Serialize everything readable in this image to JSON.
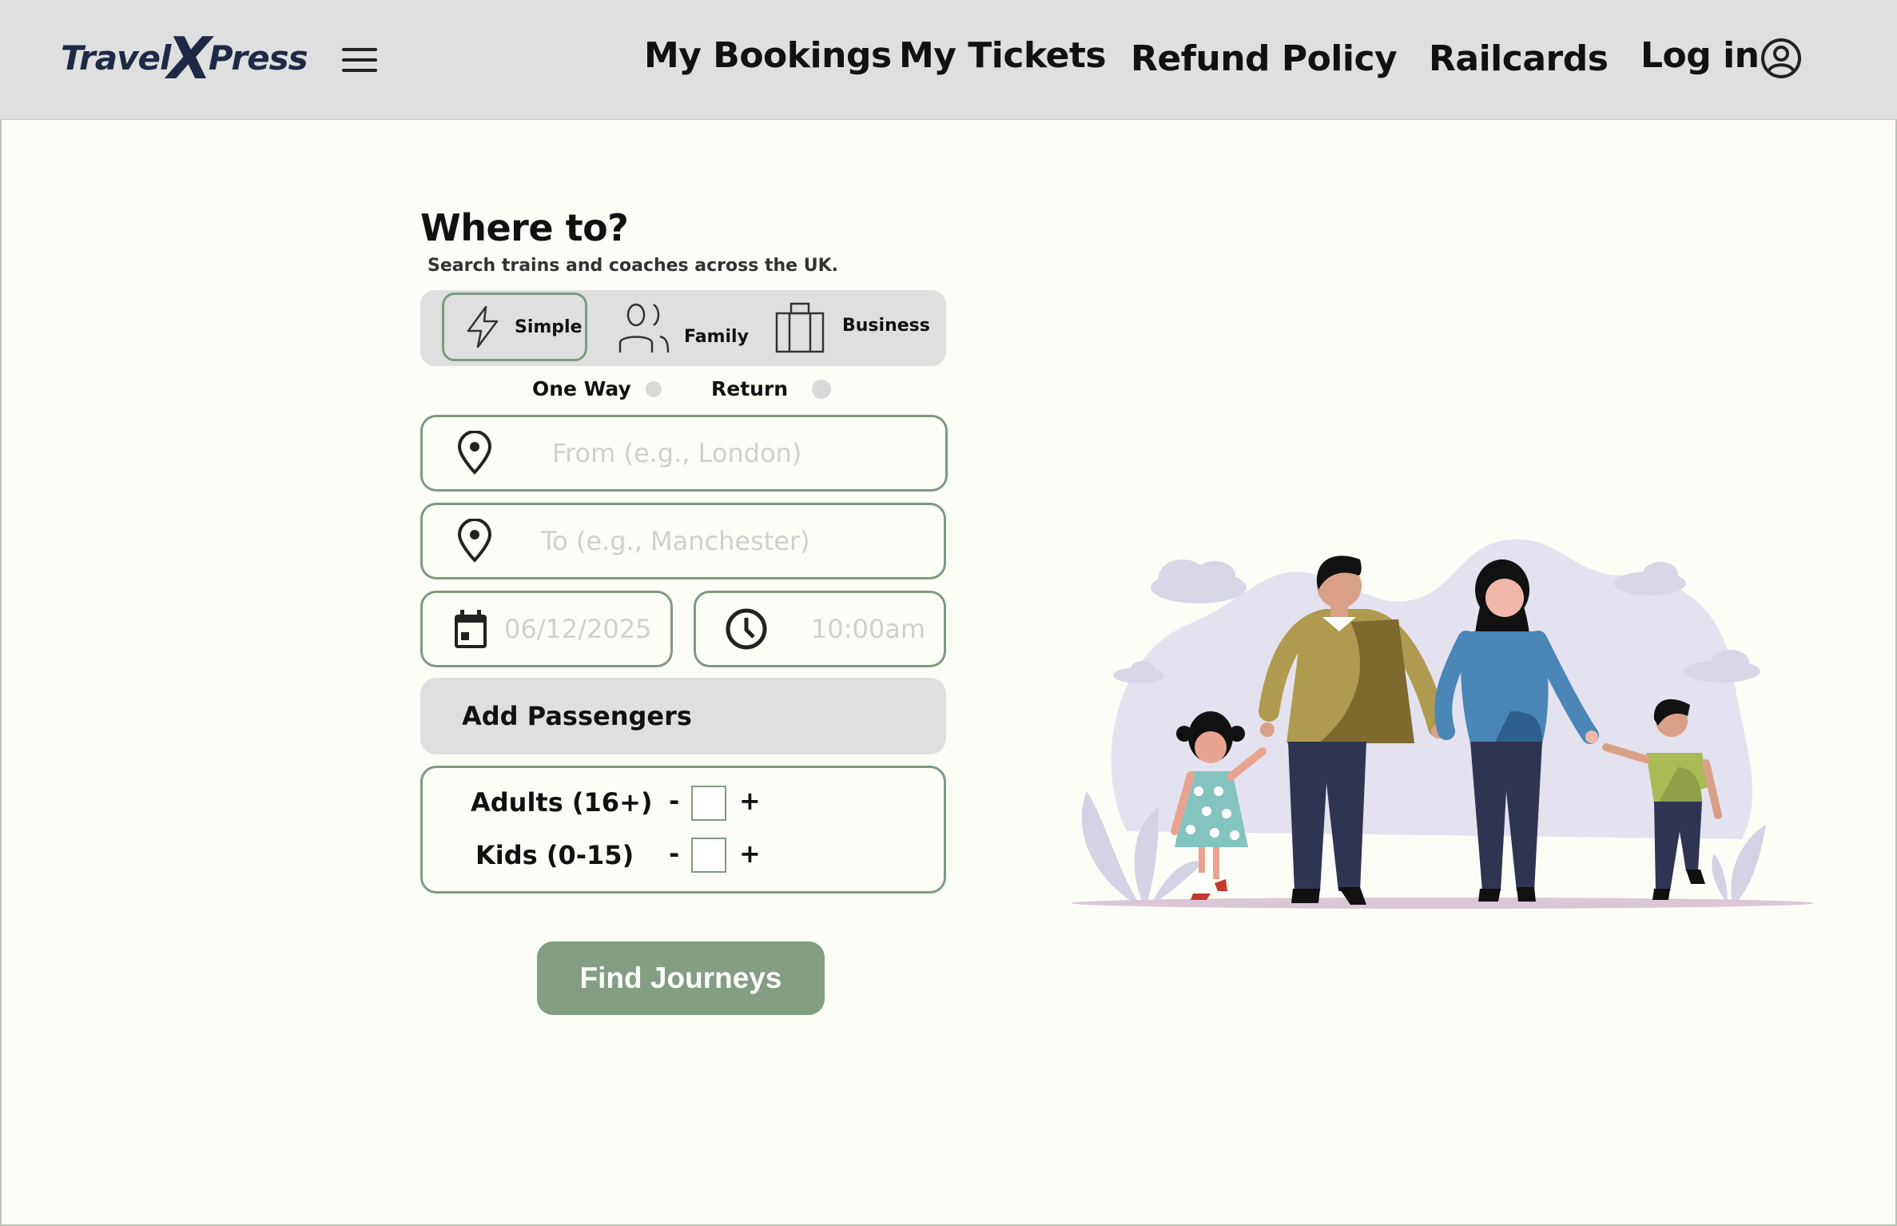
{
  "header": {
    "logo": {
      "part1": "Travel",
      "x": "X",
      "part2": "Press"
    },
    "nav": {
      "my_bookings": "My Bookings",
      "my_tickets": "My Tickets",
      "refund_policy": "Refund Policy",
      "railcards": "Railcards",
      "log_in": "Log in"
    }
  },
  "search": {
    "title": "Where to?",
    "subtitle": "Search trains and coaches across the UK.",
    "modes": {
      "simple": "Simple",
      "family": "Family",
      "business": "Business"
    },
    "selected_mode": "Simple",
    "trip_types": {
      "one_way": "One Way",
      "return": "Return"
    },
    "from": {
      "placeholder": "From (e.g., London)",
      "value": ""
    },
    "to": {
      "placeholder": "To (e.g., Manchester)",
      "value": ""
    },
    "date": {
      "placeholder": "06/12/2025"
    },
    "time": {
      "placeholder": "10:00am"
    },
    "add_passengers": "Add Passengers",
    "passengers": {
      "adults_label": "Adults (16+)",
      "kids_label": "Kids (0-15)",
      "minus": "-",
      "plus": "+"
    },
    "submit": "Find Journeys"
  },
  "colors": {
    "accent": "#839e83",
    "border": "#7f9a7f",
    "header_bg": "#dfdfdf",
    "page_bg": "#fdfdf7",
    "logo": "#1e2a45"
  }
}
